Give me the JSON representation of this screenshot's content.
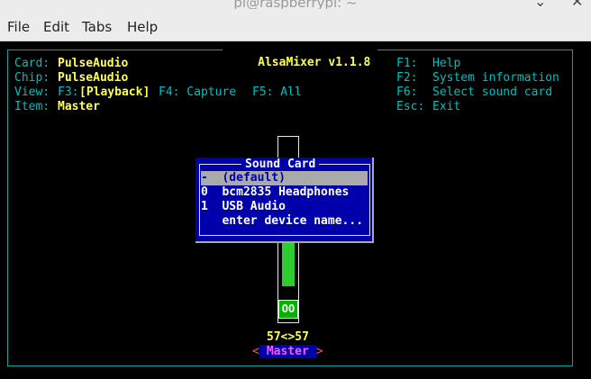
{
  "window": {
    "title": "pi@raspberrypi: ~"
  },
  "menubar": {
    "items": [
      "File",
      "Edit",
      "Tabs",
      "Help"
    ]
  },
  "alsamixer": {
    "title": "AlsaMixer v1.1.8",
    "info": {
      "card_label": "Card:",
      "card_value": "PulseAudio",
      "chip_label": "Chip:",
      "chip_value": "PulseAudio",
      "view_label": "View:",
      "view_f3": "F3:",
      "view_playback": "[Playback]",
      "view_f4": "F4: Capture",
      "view_f5": "F5: All",
      "item_label": "Item:",
      "item_value": "Master"
    },
    "keys": [
      {
        "key": "F1:",
        "action": "Help"
      },
      {
        "key": "F2:",
        "action": "System information"
      },
      {
        "key": "F6:",
        "action": "Select sound card"
      },
      {
        "key": "Esc:",
        "action": "Exit"
      }
    ],
    "channel": {
      "name": "Master",
      "volume_text": "57<>57",
      "volume_percent": 57,
      "mute_text": "OO",
      "bracket_left": "<",
      "bracket_right": ">"
    }
  },
  "sound_card_dialog": {
    "title": "Sound Card",
    "options": [
      {
        "index": "-",
        "label": "(default)",
        "selected": true
      },
      {
        "index": "0",
        "label": "bcm2835 Headphones",
        "selected": false
      },
      {
        "index": "1",
        "label": "USB Audio",
        "selected": false
      },
      {
        "index": "",
        "label": "enter device name...",
        "selected": false
      }
    ]
  },
  "colors": {
    "frame": "#00a8a8",
    "label": "#00c0c0",
    "value": "#ffff55",
    "dialog_bg": "#0000aa",
    "selection": "#aaaaaa",
    "meter": "#2ecc2e"
  }
}
